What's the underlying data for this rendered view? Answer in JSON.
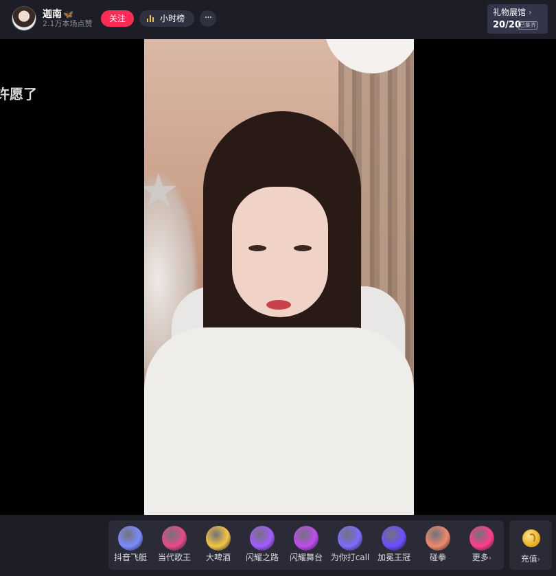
{
  "header": {
    "streamer_name": "迦南",
    "badge_glyph": "🦋",
    "likes_text": "2.1万本场点赞",
    "follow_label": "关注",
    "rank_label": "小时榜",
    "more_label": "···",
    "gift_hall": {
      "title": "礼物展馆",
      "chevron": "›",
      "count": "20/20",
      "tag": "已集齐"
    }
  },
  "overlay": {
    "wish_text": "许愿了"
  },
  "gifts": [
    {
      "label": "抖音飞艇",
      "icon": "airship-icon",
      "color": "#7b8cff"
    },
    {
      "label": "当代歌王",
      "icon": "singer-king-icon",
      "color": "#e84a8a"
    },
    {
      "label": "大啤酒",
      "icon": "beer-icon",
      "color": "#f5c542"
    },
    {
      "label": "闪耀之路",
      "icon": "shining-road-icon",
      "color": "#a35cff"
    },
    {
      "label": "闪耀舞台",
      "icon": "shining-stage-icon",
      "color": "#c04cf0"
    },
    {
      "label": "为你打call",
      "icon": "call-icon",
      "color": "#7d6bff"
    },
    {
      "label": "加冕王冠",
      "icon": "crown-icon",
      "color": "#6c4dff"
    },
    {
      "label": "碰拳",
      "icon": "fist-bump-icon",
      "color": "#f08a6a"
    },
    {
      "label": "更多",
      "icon": "gift-box-icon",
      "color": "#ff3d8b",
      "chevron": "›"
    }
  ],
  "recharge": {
    "label": "充值",
    "chevron": "›"
  },
  "colors": {
    "follow": "#fe2c55",
    "bar": "#1c1d26",
    "panel": "#2a2b37"
  }
}
